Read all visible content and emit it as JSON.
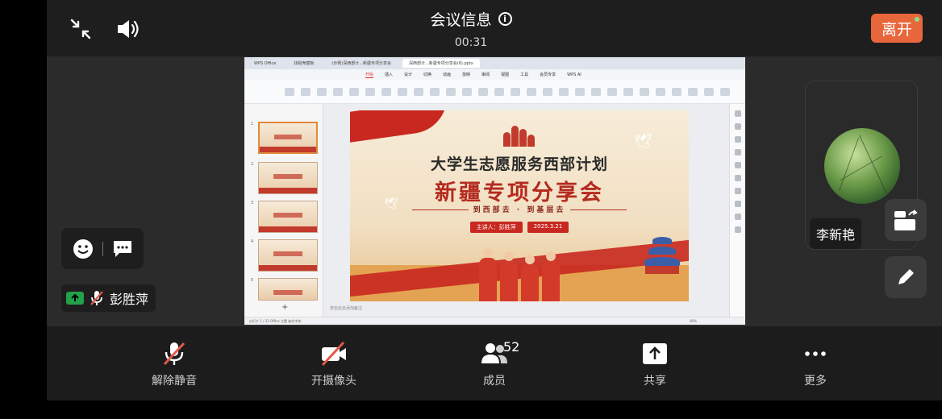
{
  "header": {
    "title": "会议信息",
    "timer": "00:31",
    "leave_label": "离开",
    "leave_color": "#e8663b"
  },
  "shared_screen": {
    "wps_tabs": [
      "WPS Office",
      "找稻壳模板",
      "(示例)深西部计...新疆专项分享会",
      "深西部计...新疆专项分享会(6).pptx"
    ],
    "wps_menus": [
      "开始",
      "插入",
      "设计",
      "切换",
      "动画",
      "放映",
      "审阅",
      "视图",
      "工具",
      "会员专享",
      "WPS AI"
    ],
    "active_menu": "开始",
    "thumb_numbers": [
      "1",
      "2",
      "3",
      "4",
      "5"
    ],
    "notes_placeholder": "单击此处添加备注",
    "status_text": "幻灯片 1 / 22   Office 主题   缺失字体",
    "zoom": "80%",
    "slide": {
      "title": "大学生志愿服务西部计划",
      "subtitle": "新疆专项分享会",
      "slogan": "到西部去 · 到基层去",
      "speaker": "主讲人：彭胜萍",
      "date": "2025.3.21"
    }
  },
  "participant": {
    "name": "李新艳"
  },
  "self": {
    "name": "彭胜萍"
  },
  "toolbar": {
    "unmute_label": "解除静音",
    "camera_label": "开摄像头",
    "members_label": "成员",
    "members_count": "52",
    "share_label": "共享",
    "more_label": "更多"
  },
  "colors": {
    "accent": "#e8663b",
    "mute_slash": "#e0584a",
    "network_ok": "#22a04a"
  }
}
